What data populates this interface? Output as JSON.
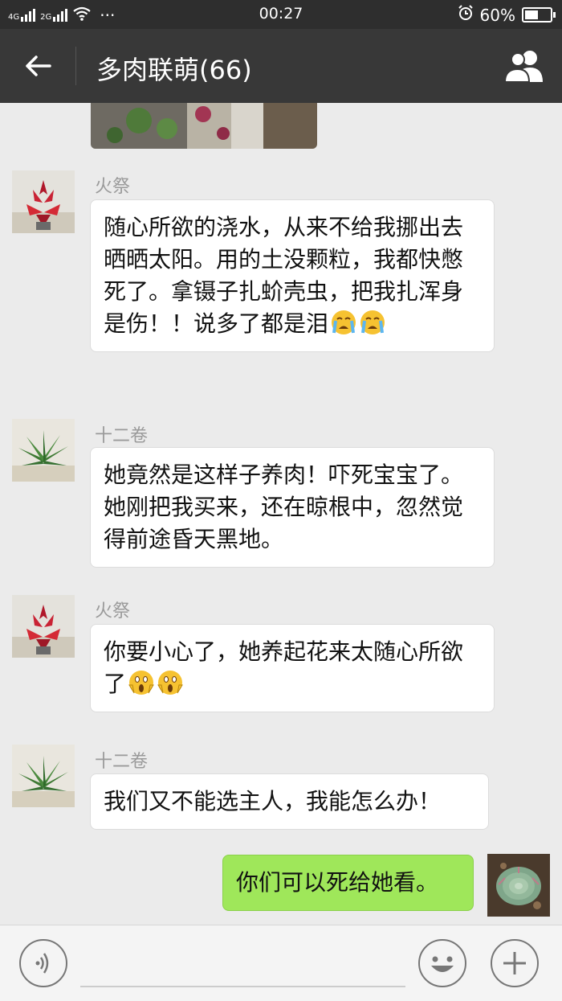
{
  "status_bar": {
    "network_1": "4G",
    "network_2": "2G",
    "more": "···",
    "time": "00:27",
    "battery_text": "60%",
    "battery_level": 0.6,
    "icons": [
      "signal-4g-icon",
      "signal-2g-icon",
      "wifi-icon",
      "alarm-icon",
      "battery-icon"
    ]
  },
  "header": {
    "title": "多肉联萌(66)",
    "icons": [
      "back-arrow-icon",
      "group-members-icon"
    ]
  },
  "messages": [
    {
      "sender": "火祭",
      "text": "随心所欲的浇水，从来不给我挪出去晒晒太阳。用的土没颗粒，我都快憋死了。拿镊子扎蚧壳虫，把我扎浑身是伤！！说多了都是泪",
      "emoji": [
        "crying-face-emoji",
        "crying-face-emoji"
      ]
    },
    {
      "sender": "十二卷",
      "text": "她竟然是这样子养肉！吓死宝宝了。她刚把我买来，还在晾根中，忽然觉得前途昏天黑地。",
      "emoji": []
    },
    {
      "sender": "火祭",
      "text": "你要小心了，她养起花来太随心所欲了",
      "emoji": [
        "screaming-face-emoji",
        "screaming-face-emoji"
      ]
    },
    {
      "sender": "十二卷",
      "text": "我们又不能选主人，我能怎么办！",
      "emoji": []
    },
    {
      "sender": "",
      "text": "你们可以死给她看。",
      "emoji": [],
      "mine": true
    }
  ],
  "input_bar": {
    "icons": [
      "voice-icon",
      "emoji-icon",
      "plus-icon"
    ]
  },
  "colors": {
    "status_bg": "#2e2e2e",
    "header_bg": "#383838",
    "chat_bg": "#ebebeb",
    "my_bubble": "#9fe75a"
  }
}
